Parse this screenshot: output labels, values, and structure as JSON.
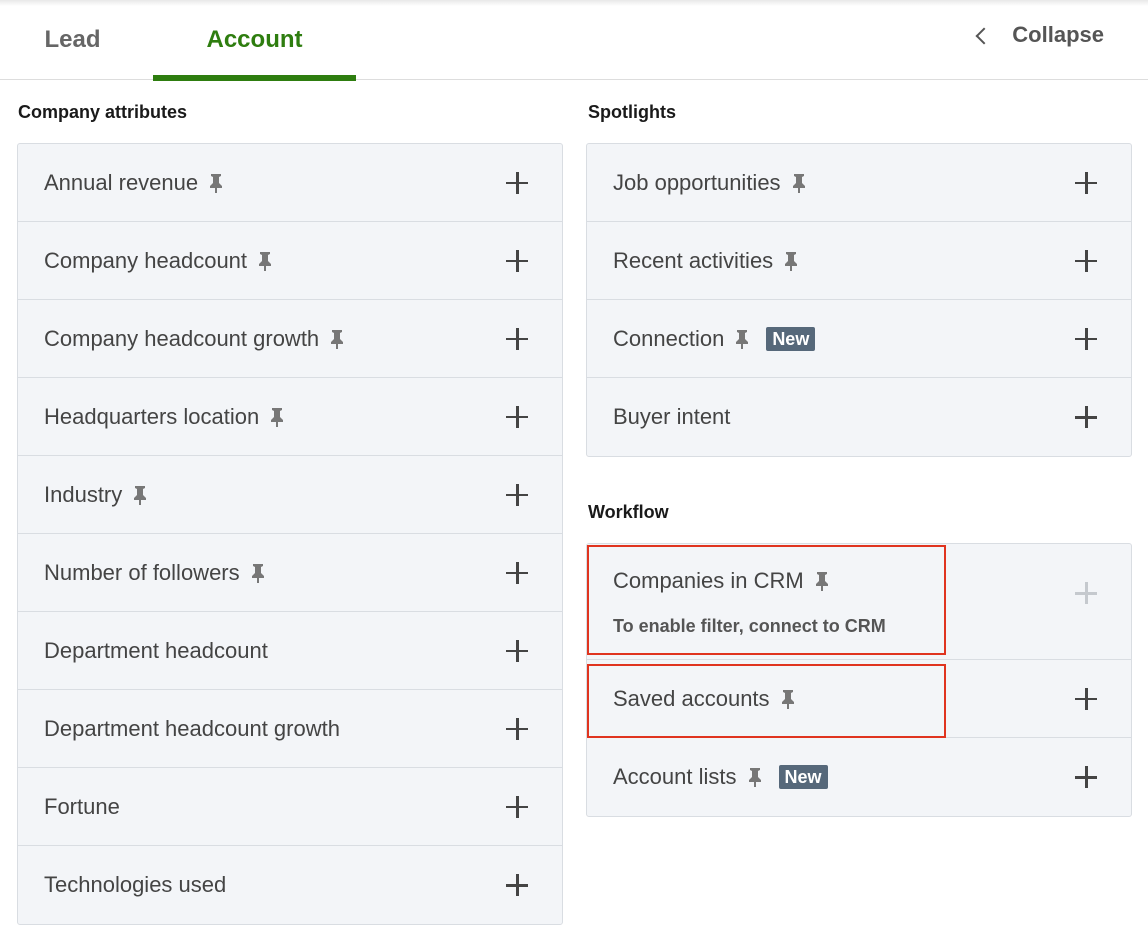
{
  "tabs": {
    "lead": "Lead",
    "account": "Account"
  },
  "collapse_label": "Collapse",
  "company_attributes": {
    "heading": "Company attributes",
    "items": [
      {
        "label": "Annual revenue",
        "pinned": true
      },
      {
        "label": "Company headcount",
        "pinned": true
      },
      {
        "label": "Company headcount growth",
        "pinned": true
      },
      {
        "label": "Headquarters location",
        "pinned": true
      },
      {
        "label": "Industry",
        "pinned": true
      },
      {
        "label": "Number of followers",
        "pinned": true
      },
      {
        "label": "Department headcount",
        "pinned": false
      },
      {
        "label": "Department headcount growth",
        "pinned": false
      },
      {
        "label": "Fortune",
        "pinned": false
      },
      {
        "label": "Technologies used",
        "pinned": false
      }
    ]
  },
  "spotlights": {
    "heading": "Spotlights",
    "items": [
      {
        "label": "Job opportunities",
        "pinned": true
      },
      {
        "label": "Recent activities",
        "pinned": true
      },
      {
        "label": "Connection",
        "pinned": true,
        "badge": "New"
      },
      {
        "label": "Buyer intent",
        "pinned": false
      }
    ]
  },
  "workflow": {
    "heading": "Workflow",
    "items": [
      {
        "label": "Companies in CRM",
        "pinned": true,
        "hint": "To enable filter, connect to CRM",
        "disabled": true
      },
      {
        "label": "Saved accounts",
        "pinned": true
      },
      {
        "label": "Account lists",
        "pinned": true,
        "badge": "New"
      }
    ]
  },
  "colors": {
    "accent": "#2e7d0f",
    "badge_bg": "#56687a",
    "highlight": "#e0341f",
    "panel_bg": "#f3f5f8"
  },
  "icons": {
    "pin": "pin-icon",
    "add": "plus-icon",
    "collapse": "chevron-left-icon"
  }
}
